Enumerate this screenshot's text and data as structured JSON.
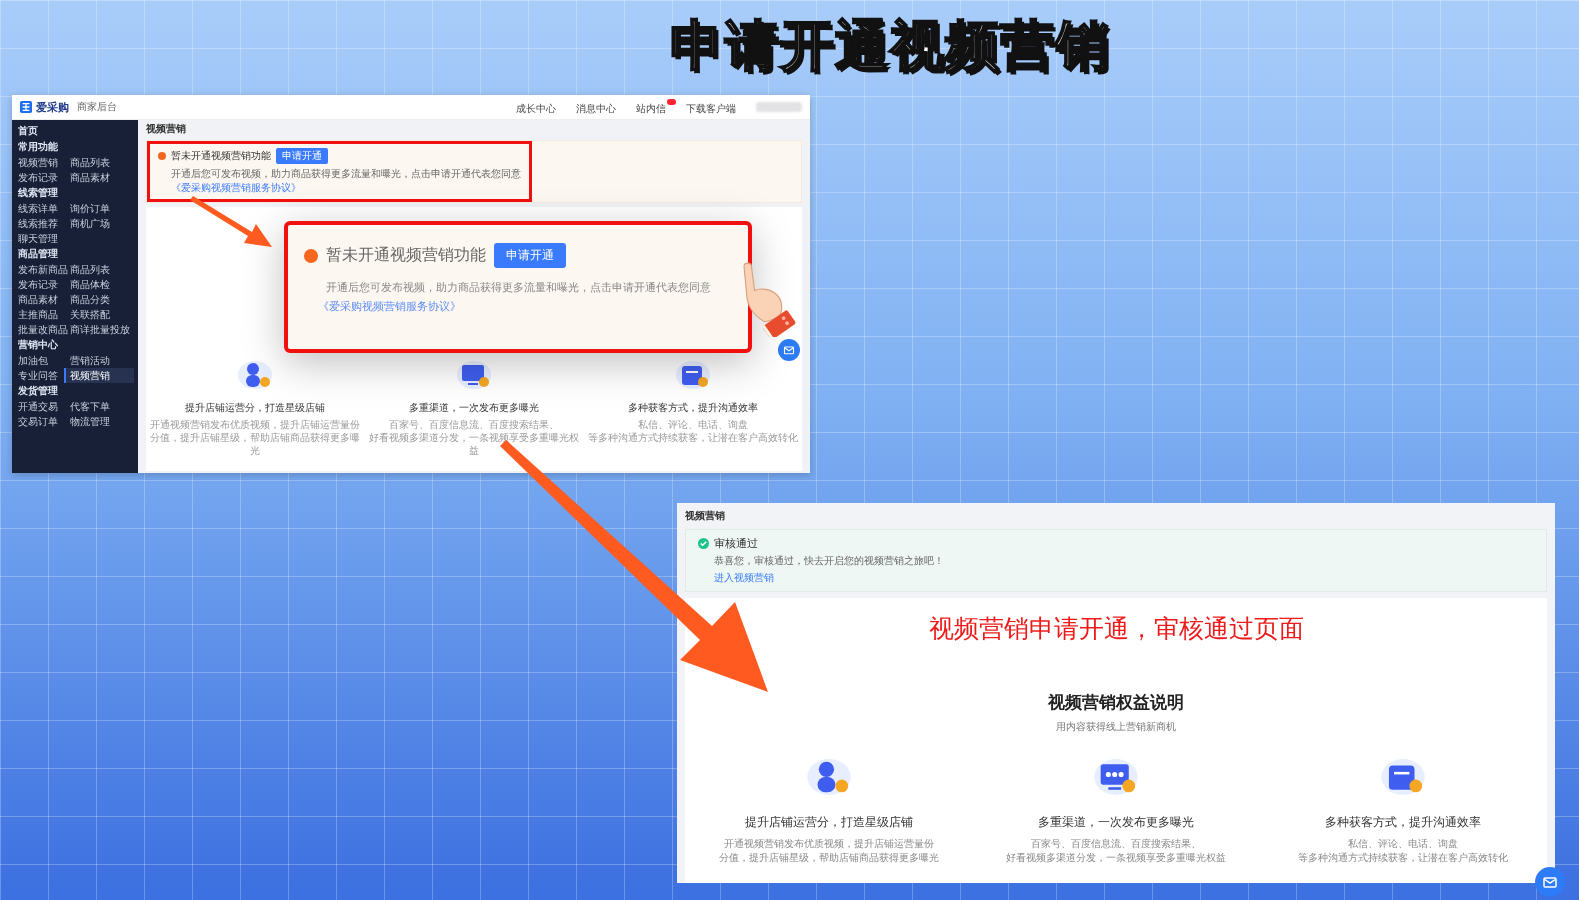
{
  "title": "申请开通视频营销",
  "before_screenshot": {
    "logo": "爱采购",
    "logo_subtitle": "商家后台",
    "header_links": [
      {
        "label": "成长中心"
      },
      {
        "label": "消息中心"
      },
      {
        "label": "站内信"
      },
      {
        "label": "下载客户端"
      }
    ],
    "sidebar": {
      "home": "首页",
      "groups": [
        {
          "label": "常用功能",
          "items": [
            {
              "label": "视频营销",
              "selected": false
            },
            {
              "label": "商品列表",
              "selected": false
            },
            {
              "label": "发布记录",
              "selected": false
            },
            {
              "label": "商品素材",
              "selected": false
            }
          ]
        },
        {
          "label": "线索管理",
          "items": [
            {
              "label": "线索详单",
              "selected": false
            },
            {
              "label": "询价订单",
              "selected": false
            },
            {
              "label": "线索推荐",
              "selected": false
            },
            {
              "label": "商机广场",
              "selected": false
            },
            {
              "label": "聊天管理",
              "selected": false
            }
          ]
        },
        {
          "label": "商品管理",
          "items": [
            {
              "label": "发布新商品",
              "selected": false
            },
            {
              "label": "商品列表",
              "selected": false
            },
            {
              "label": "发布记录",
              "selected": false
            },
            {
              "label": "商品体检",
              "selected": false
            },
            {
              "label": "商品素材",
              "selected": false
            },
            {
              "label": "商品分类",
              "selected": false
            },
            {
              "label": "主推商品",
              "selected": false
            },
            {
              "label": "关联搭配",
              "selected": false
            },
            {
              "label": "批量改商品",
              "selected": false
            },
            {
              "label": "商详批量投放",
              "selected": false
            }
          ]
        },
        {
          "label": "营销中心",
          "items": [
            {
              "label": "加油包",
              "selected": false
            },
            {
              "label": "营销活动",
              "selected": false
            },
            {
              "label": "专业问答",
              "selected": false
            },
            {
              "label": "视频营销",
              "selected": true
            }
          ]
        },
        {
          "label": "发货管理",
          "items": [
            {
              "label": "开通交易",
              "selected": false
            },
            {
              "label": "代客下单",
              "selected": false
            },
            {
              "label": "交易订单",
              "selected": false
            },
            {
              "label": "物流管理",
              "selected": false
            }
          ]
        }
      ]
    },
    "page_title": "视频营销",
    "alert": {
      "title": "暂未开通视频营销功能",
      "button": "申请开通",
      "text": "开通后您可发布视频，助力商品获得更多流量和曝光，点击申请开通代表您同意",
      "link": "《爱采购视频营销服务协议》"
    },
    "features": [
      {
        "title": "提升店铺运营分，打造星级店铺",
        "lines": [
          "开通视频营销发布优质视频，提升店铺运营量份",
          "分值，提升店铺星级，帮助店铺商品获得更多曝光"
        ]
      },
      {
        "title": "多重渠道，一次发布更多曝光",
        "lines": [
          "百家号、百度信息流、百度搜索结果、",
          "好看视频多渠道分发，一条视频享受多重曝光权益"
        ]
      },
      {
        "title": "多种获客方式，提升沟通效率",
        "lines": [
          "私信、评论、电话、询盘",
          "等多种沟通方式持续获客，让潜在客户高效转化"
        ]
      }
    ]
  },
  "callout": {
    "title": "暂未开通视频营销功能",
    "button": "申请开通",
    "text": "开通后您可发布视频，助力商品获得更多流量和曝光，点击申请开通代表您同意",
    "link": "《爱采购视频营销服务协议》"
  },
  "after_screenshot": {
    "page_title": "视频营销",
    "alert": {
      "title": "审核通过",
      "text": "恭喜您，审核通过，快去开启您的视频营销之旅吧！",
      "link": "进入视频营销"
    },
    "annotation": "视频营销申请开通，审核通过页面",
    "heading": "视频营销权益说明",
    "subheading": "用内容获得线上营销新商机",
    "features": [
      {
        "title": "提升店铺运营分，打造星级店铺",
        "lines": [
          "开通视频营销发布优质视频，提升店铺运营量份",
          "分值，提升店铺星级，帮助店铺商品获得更多曝光"
        ]
      },
      {
        "title": "多重渠道，一次发布更多曝光",
        "lines": [
          "百家号、百度信息流、百度搜索结果、",
          "好看视频多渠道分发，一条视频享受多重曝光权益"
        ]
      },
      {
        "title": "多种获客方式，提升沟通效率",
        "lines": [
          "私信、评论、电话、询盘",
          "等多种沟通方式持续获客，让潜在客户高效转化"
        ]
      }
    ]
  }
}
